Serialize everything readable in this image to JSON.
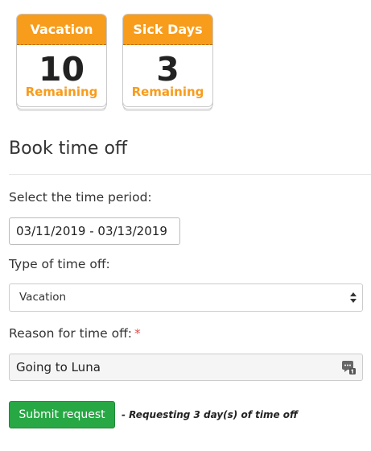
{
  "summary_cards": [
    {
      "title": "Vacation",
      "count": "10",
      "caption": "Remaining"
    },
    {
      "title": "Sick Days",
      "count": "3",
      "caption": "Remaining"
    }
  ],
  "form": {
    "title": "Book time off",
    "period_label": "Select the time period:",
    "period_value": "03/11/2019 - 03/13/2019",
    "type_label": "Type of time off:",
    "type_value": "Vacation",
    "reason_label": "Reason for time off:",
    "required_marker": "*",
    "reason_value": "Going to Luna",
    "submit_label": "Submit request",
    "request_note": "- Requesting 3 day(s) of time off"
  },
  "colors": {
    "card_accent": "#f89c1c",
    "submit_green": "#27a844",
    "required_red": "#d9534f"
  },
  "icons": {
    "select_arrows": "sort-arrows-icon",
    "reason_field": "text-counter-icon"
  }
}
